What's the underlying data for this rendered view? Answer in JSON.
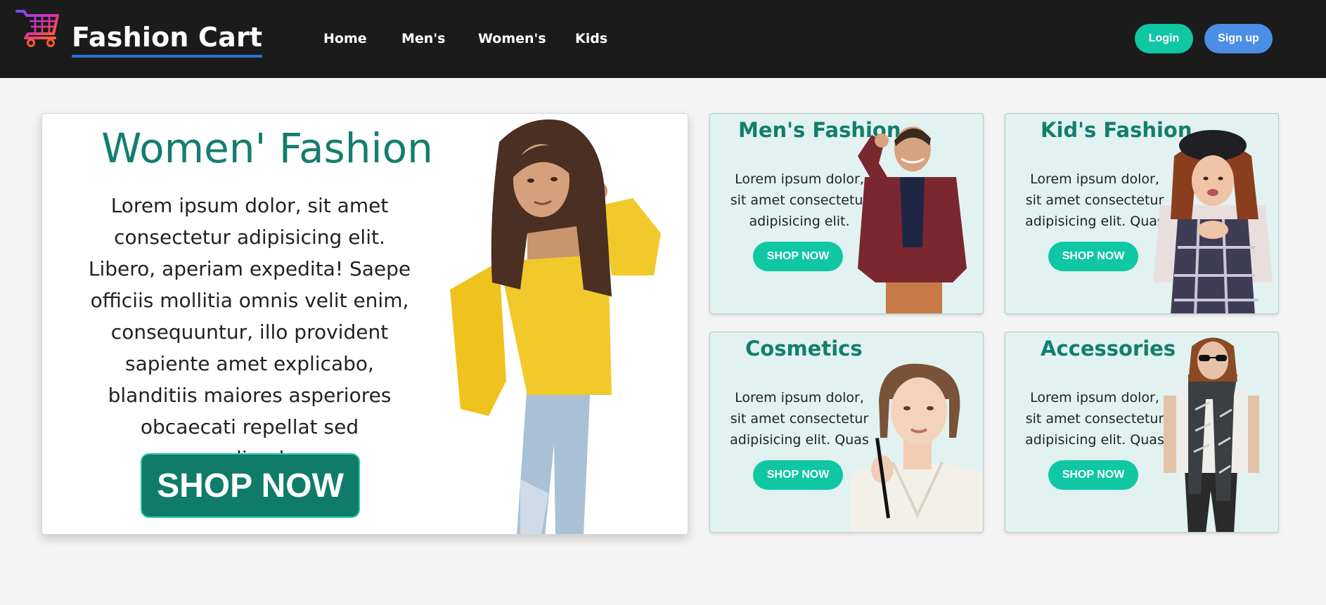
{
  "header": {
    "brand": "Fashion Cart",
    "nav": [
      {
        "label": "Home"
      },
      {
        "label": "Men's"
      },
      {
        "label": "Women's"
      },
      {
        "label": "Kids"
      }
    ],
    "login_label": "Login",
    "signup_label": "Sign up"
  },
  "hero": {
    "title": "Women' Fashion",
    "text": "Lorem ipsum dolor, sit amet consectetur adipisicing elit. Libero, aperiam expedita! Saepe officiis mollitia omnis velit enim, consequuntur, illo provident sapiente amet explicabo, blanditiis maiores asperiores obcaecati repellat sed repudiandae.",
    "button": "SHOP NOW"
  },
  "cards": [
    {
      "title": "Men's Fashion",
      "text": "Lorem ipsum dolor, sit amet consectetur adipisicing elit.",
      "button": "SHOP NOW"
    },
    {
      "title": "Kid's Fashion",
      "text": "Lorem ipsum dolor, sit amet consectetur adipisicing elit. Quas",
      "button": "SHOP NOW"
    },
    {
      "title": "Cosmetics",
      "text": "Lorem ipsum dolor, sit amet consectetur adipisicing elit. Quas",
      "button": "SHOP NOW"
    },
    {
      "title": "Accessories",
      "text": "Lorem ipsum dolor, sit amet consectetur adipisicing elit. Quas",
      "button": "SHOP NOW"
    }
  ],
  "colors": {
    "header_bg": "#1b1b1b",
    "accent_teal": "#10c7a4",
    "title_teal": "#137e6d",
    "signup_blue": "#4a8ee6",
    "card_bg": "#e1f2f1"
  },
  "icons": {
    "logo": "shopping-cart-icon"
  }
}
